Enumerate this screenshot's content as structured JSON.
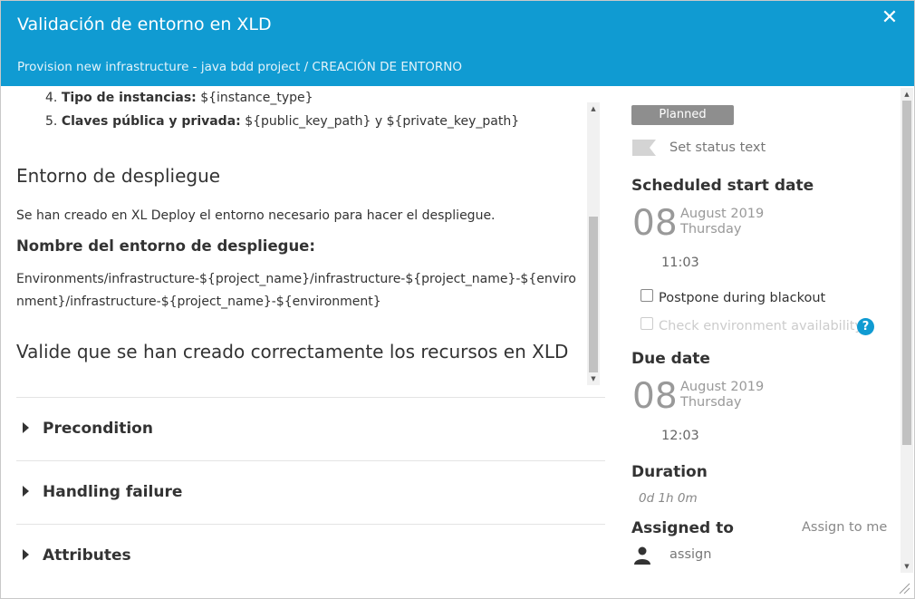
{
  "header": {
    "title": "Validación de entorno en XLD",
    "subtitle": "Provision new infrastructure - java bdd project / CREACIÓN DE ENTORNO",
    "close_icon": "close-icon"
  },
  "description": {
    "list_items": [
      {
        "number": "4.",
        "label": "Tipo de instancias:",
        "value": "${instance_type}"
      },
      {
        "number": "5.",
        "label": "Claves pública y privada:",
        "value": "${public_key_path} y ${private_key_path}"
      }
    ],
    "heading_env": "Entorno de despliegue",
    "paragraph_created": "Se han creado en XL Deploy el entorno necesario para hacer el despliegue.",
    "heading_env_name": "Nombre del entorno de despliegue:",
    "env_path": "Environments/infrastructure-${project_name}/infrastructure-${project_name}-${environment}/infrastructure-${project_name}-${environment}",
    "heading_validate": "Valide que se han creado correctamente los recursos en XLD"
  },
  "sections": [
    {
      "label": "Precondition"
    },
    {
      "label": "Handling failure"
    },
    {
      "label": "Attributes"
    }
  ],
  "sidebar": {
    "status_badge": "Planned",
    "set_status_text": "Set status text",
    "scheduled_start": {
      "label": "Scheduled start date",
      "day": "08",
      "month_year": "August 2019",
      "weekday": "Thursday",
      "time": "11:03"
    },
    "postpone_label": "Postpone during blackout",
    "check_env_label": "Check environment availability",
    "help_icon": "?",
    "due": {
      "label": "Due date",
      "day": "08",
      "month_year": "August 2019",
      "weekday": "Thursday",
      "time": "12:03"
    },
    "duration_label": "Duration",
    "duration_value": "0d 1h 0m",
    "assigned_to_label": "Assigned to",
    "assign_to_me": "Assign to me",
    "assign_placeholder": "assign"
  },
  "colors": {
    "header": "#109bd2",
    "badge": "#8e8e8e",
    "help": "#109bd2"
  }
}
